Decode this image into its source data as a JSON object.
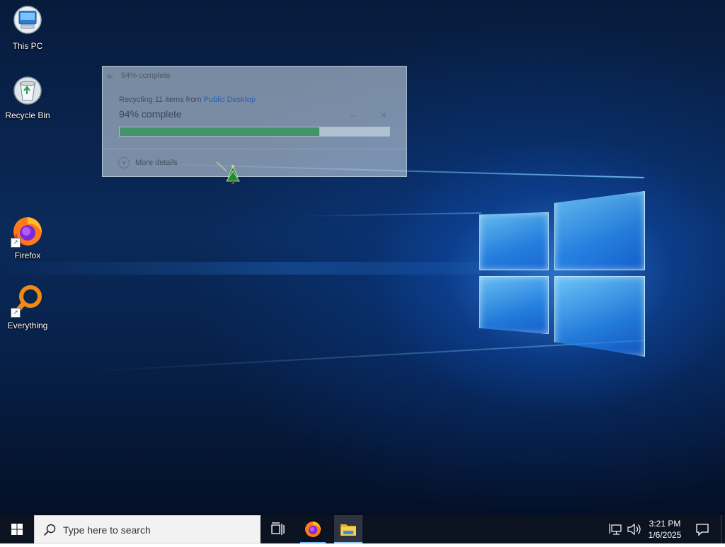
{
  "desktop": {
    "icons": [
      {
        "label": "This PC"
      },
      {
        "label": "Recycle Bin"
      },
      {
        "label": "Firefox"
      },
      {
        "label": "Everything"
      }
    ]
  },
  "progress_dialog": {
    "title": "94% complete",
    "status_prefix": "Recycling 11 items from ",
    "status_location": "Public Desktop",
    "big_status": "94% complete",
    "progress_fraction": 0.74,
    "minimize_glyph": "–",
    "close_glyph": "✕",
    "more_details_label": "More details",
    "more_details_glyph": "˅"
  },
  "taskbar": {
    "search_placeholder": "Type here to search",
    "pinned": [
      {
        "icon": "task-view-icon"
      },
      {
        "icon": "firefox-icon"
      },
      {
        "icon": "file-explorer-icon"
      }
    ],
    "clock": {
      "time": "3:21 PM",
      "date": "1/6/2025"
    }
  },
  "colors": {
    "taskbar_bg": "#0b1220",
    "progress_green": "#14823c",
    "accent_blue": "#7cb6f2"
  }
}
